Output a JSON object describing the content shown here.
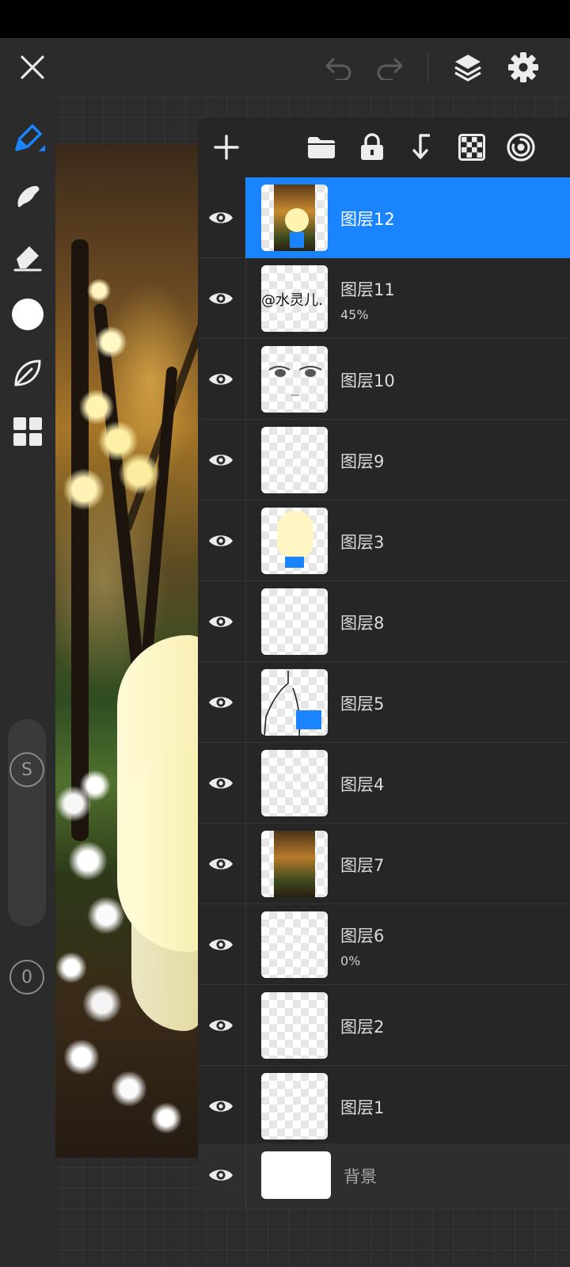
{
  "top_bar": {
    "close_icon": "close-icon",
    "undo_icon": "undo-icon",
    "redo_icon": "redo-icon",
    "layers_icon": "layers-icon",
    "settings_icon": "gear-icon"
  },
  "left_toolbar": {
    "tools": [
      "pen-icon",
      "smudge-icon",
      "eraser-icon",
      "color-swatch",
      "leaf-icon",
      "grid-icon"
    ],
    "active_color": "#ffffff",
    "size_slider_label": "S",
    "opacity_slider_label": "0"
  },
  "panel_toolbar": {
    "icons": [
      "add-layer-icon",
      "folder-icon",
      "lock-icon",
      "merge-down-icon",
      "transparency-icon",
      "target-icon"
    ]
  },
  "layers": [
    {
      "name": "图层12",
      "opacity": "",
      "selected": true
    },
    {
      "name": "图层11",
      "opacity": "45%",
      "thumb_text": "@水灵儿."
    },
    {
      "name": "图层10",
      "opacity": ""
    },
    {
      "name": "图层9",
      "opacity": ""
    },
    {
      "name": "图层3",
      "opacity": ""
    },
    {
      "name": "图层8",
      "opacity": ""
    },
    {
      "name": "图层5",
      "opacity": ""
    },
    {
      "name": "图层4",
      "opacity": ""
    },
    {
      "name": "图层7",
      "opacity": ""
    },
    {
      "name": "图层6",
      "opacity": "0%"
    },
    {
      "name": "图层2",
      "opacity": ""
    },
    {
      "name": "图层1",
      "opacity": ""
    }
  ],
  "background_layer": {
    "name": "背景"
  },
  "colors": {
    "accent": "#1a84ff",
    "panel": "#262626",
    "toolbar": "#2b2b2b"
  }
}
